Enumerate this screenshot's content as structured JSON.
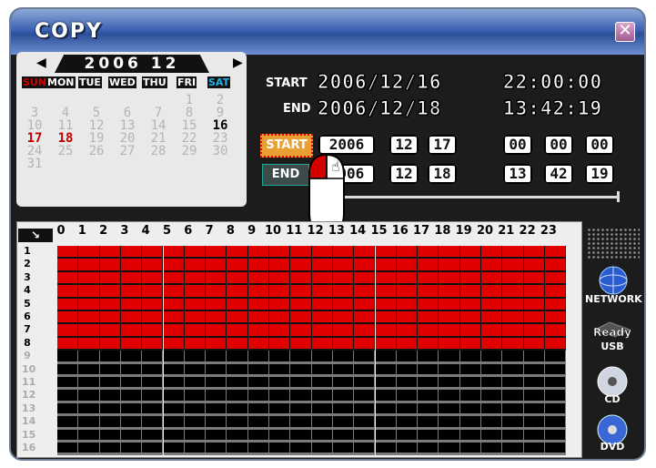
{
  "window": {
    "title": "COPY",
    "close_glyph": "✕"
  },
  "calendar": {
    "prev_arrow": "◀",
    "next_arrow": "▶",
    "year_month": "2006  12",
    "weekdays": [
      "SUN",
      "MON",
      "TUE",
      "WED",
      "THU",
      "FRI",
      "SAT"
    ],
    "days": [
      [
        "",
        "",
        "",
        "",
        "",
        "1",
        "2"
      ],
      [
        "3",
        "4",
        "5",
        "6",
        "7",
        "8",
        "9"
      ],
      [
        "10",
        "11",
        "12",
        "13",
        "14",
        "15",
        "16"
      ],
      [
        "17",
        "18",
        "19",
        "20",
        "21",
        "22",
        "23"
      ],
      [
        "24",
        "25",
        "26",
        "27",
        "28",
        "29",
        "30"
      ],
      [
        "31",
        "",
        "",
        "",
        "",
        "",
        ""
      ]
    ],
    "highlight": {
      "16": "#000000",
      "17": "#c00000",
      "18": "#c00000"
    }
  },
  "range": {
    "start_label": "START",
    "end_label": "END",
    "start_date": "2006/12/16",
    "start_time": "22:00:00",
    "end_date": "2006/12/18",
    "end_time": "13:42:19"
  },
  "controls": {
    "start_button": "START",
    "end_button": "END",
    "start": {
      "year": "2006",
      "month": "12",
      "day": "17",
      "hh": "00",
      "mm": "00",
      "ss": "00"
    },
    "end": {
      "year": "2006",
      "month": "12",
      "day": "18",
      "hh": "13",
      "mm": "42",
      "ss": "19"
    }
  },
  "grid": {
    "corner_glyph": "↘",
    "hours": [
      "0",
      "1",
      "2",
      "3",
      "4",
      "5",
      "6",
      "7",
      "8",
      "9",
      "10",
      "11",
      "12",
      "13",
      "14",
      "15",
      "16",
      "17",
      "18",
      "19",
      "20",
      "21",
      "22",
      "23"
    ],
    "channels": [
      "1",
      "2",
      "3",
      "4",
      "5",
      "6",
      "7",
      "8",
      "9",
      "10",
      "11",
      "12",
      "13",
      "14",
      "15",
      "16"
    ],
    "active_channels": 8,
    "colors": {
      "active": "#e00000",
      "inactive": "#000000",
      "gap": "#7b7b7b"
    }
  },
  "side": {
    "network_label": "NETWORK",
    "usb_status": "Ready",
    "usb_label": "USB",
    "cd_label": "CD",
    "dvd_label": "DVD"
  }
}
